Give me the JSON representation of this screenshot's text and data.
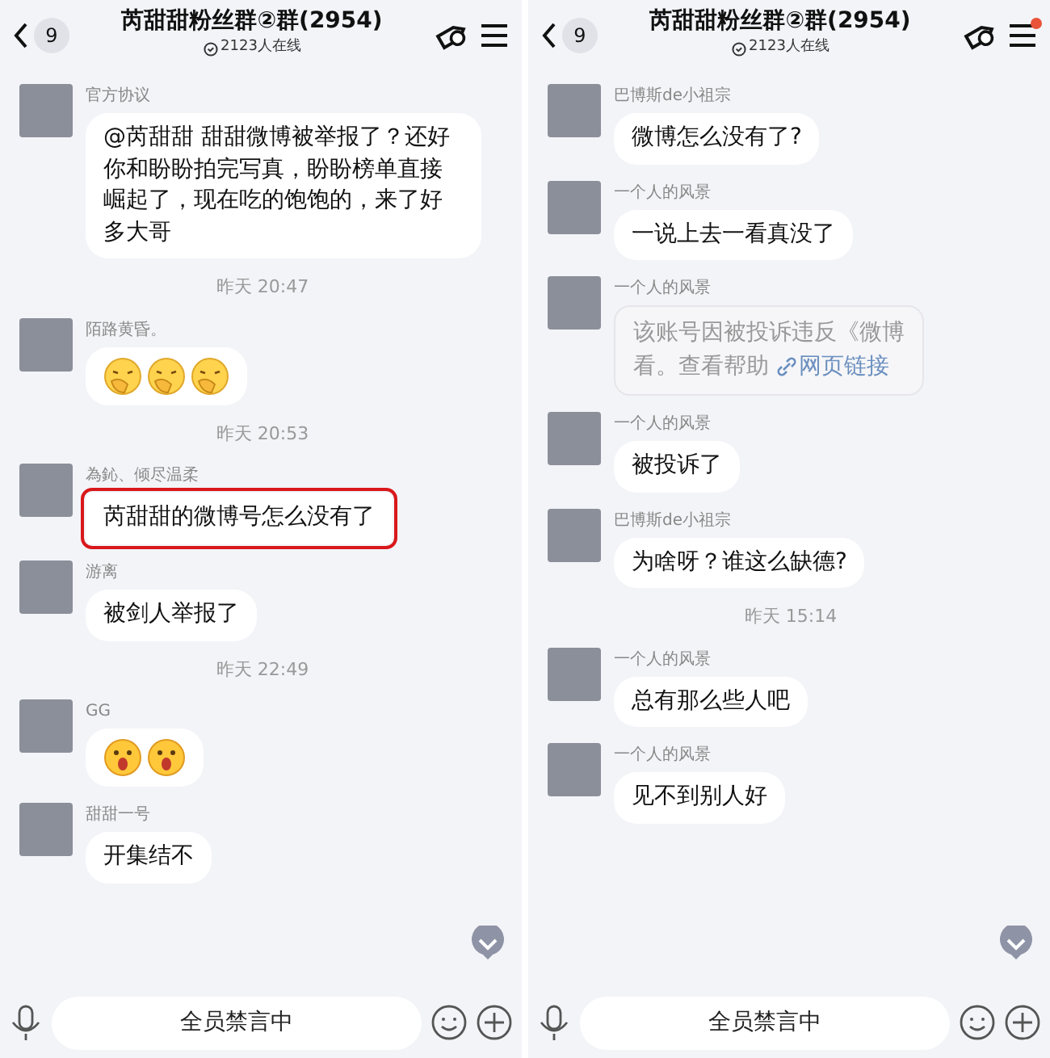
{
  "panels": [
    {
      "header": {
        "back_count": "9",
        "title": "芮甜甜粉丝群②群(2954)",
        "online": "2123人在线",
        "menu_badge": false
      },
      "messages": [
        {
          "kind": "text",
          "sender": "官方协议",
          "text": "@芮甜甜 甜甜微博被举报了？还好你和盼盼拍完写真，盼盼榜单直接崛起了，现在吃的饱饱的，来了好多大哥",
          "highlighted": false
        },
        {
          "kind": "timestamp",
          "text": "昨天 20:47"
        },
        {
          "kind": "emoji",
          "sender": "陌路黄昏。",
          "emojis": [
            {
              "kind": "covering-mouth"
            },
            {
              "kind": "covering-mouth"
            },
            {
              "kind": "covering-mouth"
            }
          ]
        },
        {
          "kind": "timestamp",
          "text": "昨天 20:53"
        },
        {
          "kind": "text",
          "sender": "為鈊、倾尽温柔",
          "text": "芮甜甜的微博号怎么没有了",
          "highlighted": true
        },
        {
          "kind": "text",
          "sender": "游离",
          "text": "被剑人举报了",
          "highlighted": false
        },
        {
          "kind": "timestamp",
          "text": "昨天 22:49"
        },
        {
          "kind": "emoji",
          "sender": "GG",
          "emojis": [
            {
              "kind": "surprised"
            },
            {
              "kind": "surprised"
            }
          ]
        },
        {
          "kind": "text",
          "sender": "甜甜一号",
          "text": "开集结不",
          "highlighted": false
        }
      ],
      "input": {
        "text": "全员禁言中"
      }
    },
    {
      "header": {
        "back_count": "9",
        "title": "芮甜甜粉丝群②群(2954)",
        "online": "2123人在线",
        "menu_badge": true
      },
      "messages": [
        {
          "kind": "text",
          "sender": "巴博斯de小祖宗",
          "text": "微博怎么没有了?",
          "highlighted": false
        },
        {
          "kind": "text",
          "sender": "一个人的风景",
          "text": "一说上去一看真没了",
          "highlighted": false
        },
        {
          "kind": "link-card",
          "sender": "一个人的风景",
          "lines": [
            "该账号因被投诉违反《微博",
            "看。查看帮助"
          ],
          "link": "网页链接"
        },
        {
          "kind": "text",
          "sender": "一个人的风景",
          "text": "被投诉了",
          "highlighted": false
        },
        {
          "kind": "text",
          "sender": "巴博斯de小祖宗",
          "text": "为啥呀？谁这么缺德?",
          "highlighted": false
        },
        {
          "kind": "timestamp",
          "text": "昨天 15:14"
        },
        {
          "kind": "text",
          "sender": "一个人的风景",
          "text": "总有那么些人吧",
          "highlighted": false
        },
        {
          "kind": "text",
          "sender": "一个人的风景",
          "text": "见不到别人好",
          "highlighted": false
        }
      ],
      "input": {
        "text": "全员禁言中"
      }
    }
  ]
}
